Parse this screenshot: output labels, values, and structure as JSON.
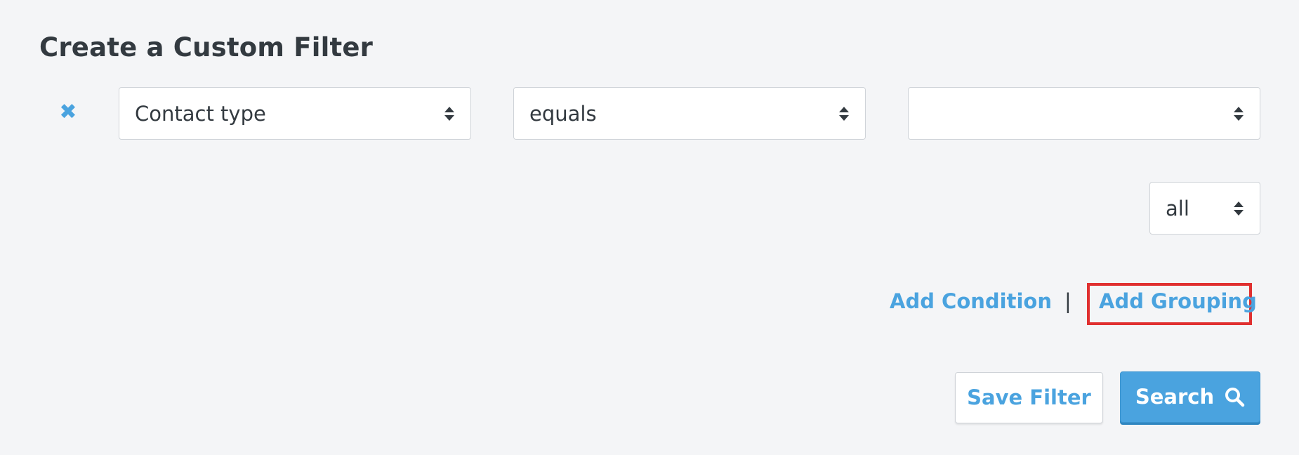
{
  "page": {
    "title": "Create a Custom Filter"
  },
  "condition": {
    "remove_icon": "close-icon",
    "field_value": "Contact type",
    "operator_value": "equals",
    "value_value": ""
  },
  "grouping": {
    "match_value": "all"
  },
  "actions": {
    "add_condition_label": "Add Condition",
    "divider": "|",
    "add_grouping_label": "Add Grouping"
  },
  "buttons": {
    "save_filter_label": "Save Filter",
    "search_label": "Search",
    "search_icon": "search-icon"
  },
  "colors": {
    "accent": "#4aa3df",
    "highlight_border": "#e03030",
    "background": "#f4f5f7"
  }
}
